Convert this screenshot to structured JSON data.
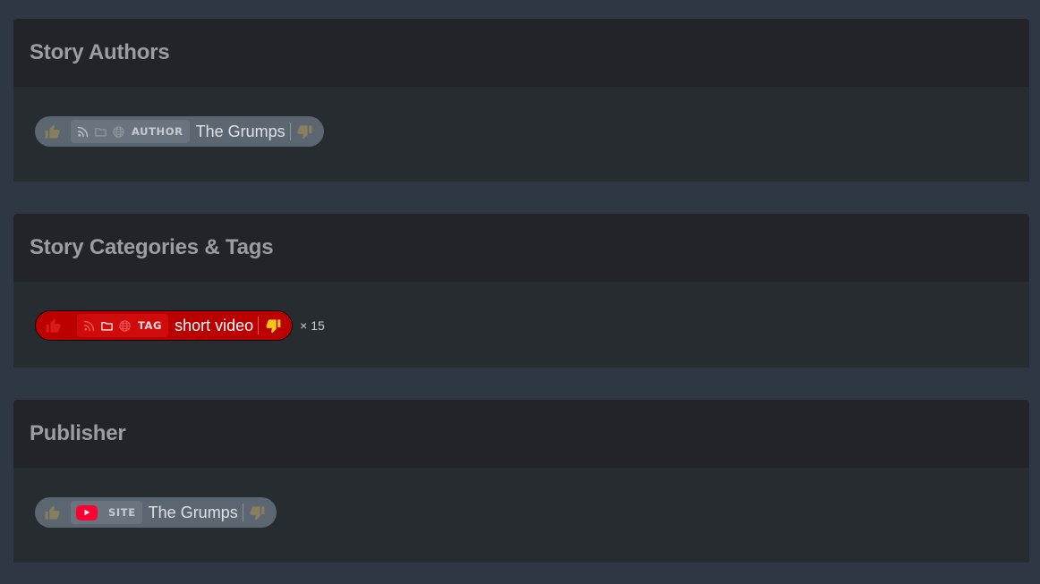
{
  "sections": [
    {
      "title": "Story Authors",
      "chip": {
        "type_label": "AUTHOR",
        "name": "The Grumps"
      }
    },
    {
      "title": "Story Categories & Tags",
      "chip": {
        "type_label": "TAG",
        "name": "short video",
        "count": "× 15"
      }
    },
    {
      "title": "Publisher",
      "chip": {
        "type_label": "SITE",
        "name": "The Grumps"
      }
    }
  ],
  "colors": {
    "page_bg": "#2f3744",
    "header_bg": "#222429",
    "body_bg": "#272c31",
    "chip_default": "#5b6671",
    "chip_disliked": "#bb0000",
    "dislike_active": "#f5c518",
    "youtube_red": "#ff0033"
  },
  "icons": [
    "thumbs-up-icon",
    "rss-icon",
    "folder-icon",
    "globe-icon",
    "thumbs-down-icon",
    "youtube-icon"
  ]
}
